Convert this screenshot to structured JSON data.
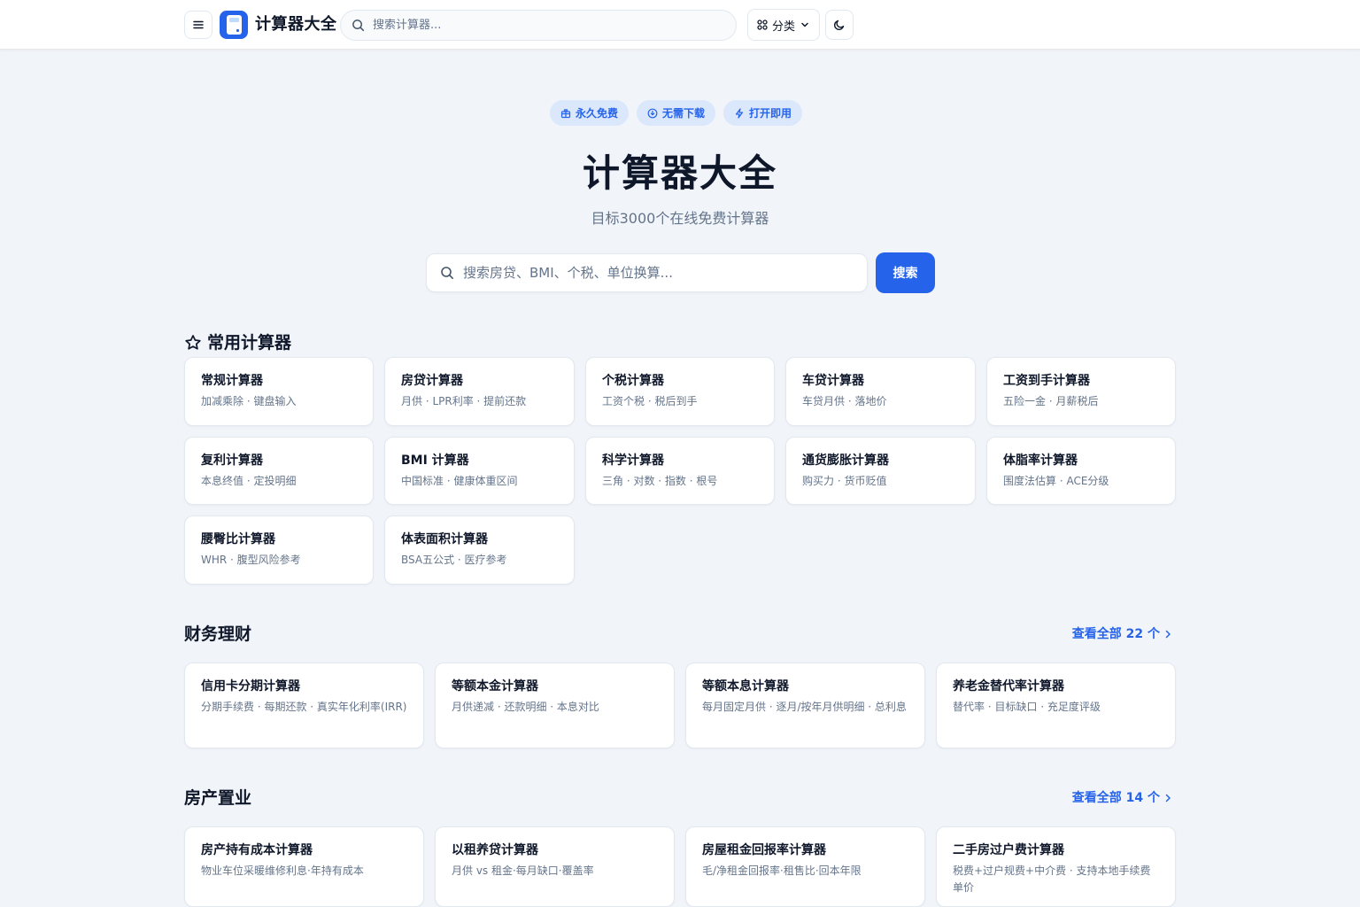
{
  "nav": {
    "brand": "计算器大全",
    "search_placeholder": "搜索计算器...",
    "category_label": "分类",
    "icons": {
      "menu": "menu-icon",
      "logo": "calculator-logo",
      "search": "search-icon",
      "category": "grid-icon",
      "chevron": "chevron-down-icon",
      "theme": "moon-icon"
    }
  },
  "hero": {
    "badges": [
      {
        "label": "永久免费",
        "icon": "gift-icon"
      },
      {
        "label": "无需下载",
        "icon": "download-icon"
      },
      {
        "label": "打开即用",
        "icon": "lightning-icon"
      }
    ],
    "title": "计算器大全",
    "subtitle": "目标3000个在线免费计算器",
    "search_placeholder": "搜索房贷、BMI、个税、单位换算...",
    "search_button": "搜索"
  },
  "sections": {
    "common": {
      "title": "常用计算器",
      "icon": "star-icon",
      "cards": [
        {
          "title": "常规计算器",
          "desc": "加减乘除 · 键盘输入"
        },
        {
          "title": "房贷计算器",
          "desc": "月供 · LPR利率 · 提前还款"
        },
        {
          "title": "个税计算器",
          "desc": "工资个税 · 税后到手"
        },
        {
          "title": "车贷计算器",
          "desc": "车贷月供 · 落地价"
        },
        {
          "title": "工资到手计算器",
          "desc": "五险一金 · 月薪税后"
        },
        {
          "title": "复利计算器",
          "desc": "本息终值 · 定投明细"
        },
        {
          "title": "BMI 计算器",
          "desc": "中国标准 · 健康体重区间"
        },
        {
          "title": "科学计算器",
          "desc": "三角 · 对数 · 指数 · 根号"
        },
        {
          "title": "通货膨胀计算器",
          "desc": "购买力 · 货币贬值"
        },
        {
          "title": "体脂率计算器",
          "desc": "围度法估算 · ACE分级"
        },
        {
          "title": "腰臀比计算器",
          "desc": "WHR · 腹型风险参考"
        },
        {
          "title": "体表面积计算器",
          "desc": "BSA五公式 · 医疗参考"
        }
      ]
    },
    "finance": {
      "title": "财务理财",
      "view_all": "查看全部 22 个",
      "cards": [
        {
          "title": "信用卡分期计算器",
          "desc": "分期手续费 · 每期还款 · 真实年化利率(IRR)"
        },
        {
          "title": "等额本金计算器",
          "desc": "月供递减 · 还款明细 · 本息对比"
        },
        {
          "title": "等额本息计算器",
          "desc": "每月固定月供 · 逐月/按年月供明细 · 总利息"
        },
        {
          "title": "养老金替代率计算器",
          "desc": "替代率 · 目标缺口 · 充足度评级"
        }
      ]
    },
    "property": {
      "title": "房产置业",
      "view_all": "查看全部 14 个",
      "cards": [
        {
          "title": "房产持有成本计算器",
          "desc": "物业车位采暖维修利息·年持有成本"
        },
        {
          "title": "以租养贷计算器",
          "desc": "月供 vs 租金·每月缺口·覆盖率"
        },
        {
          "title": "房屋租金回报率计算器",
          "desc": "毛/净租金回报率·租售比·回本年限"
        },
        {
          "title": "二手房过户费计算器",
          "desc": "税费+过户规费+中介费 · 支持本地手续费单价"
        }
      ]
    }
  },
  "colors": {
    "accent": "#2563eb",
    "badge_bg": "#dbe7fb",
    "page_bg": "#f1f4f9"
  }
}
